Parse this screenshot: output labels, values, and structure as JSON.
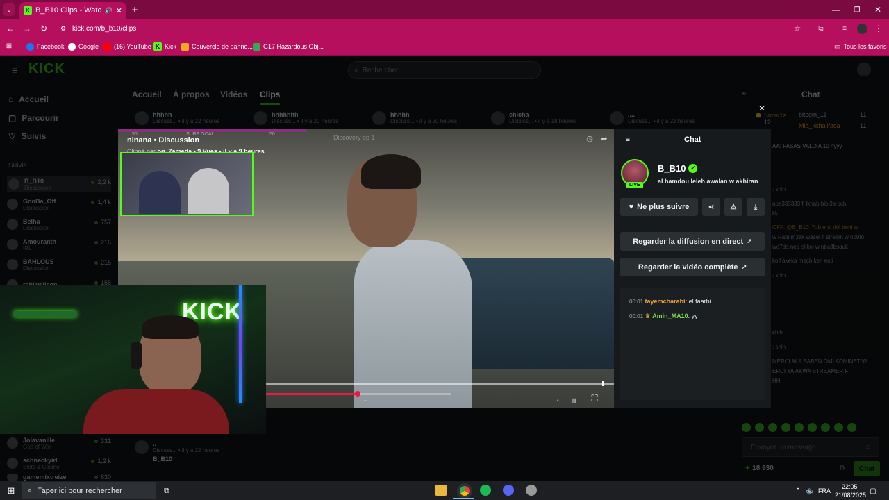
{
  "browser": {
    "tab_title": "B_B10 Clips - Watch Live o",
    "url": "kick.com/b_b10/clips",
    "bookmarks": [
      "Facebook",
      "Google",
      "(16) YouTube",
      "Kick",
      "Couvercle de panne...",
      "G17 Hazardous Obj..."
    ],
    "all_bookmarks": "Tous les favoris"
  },
  "site": {
    "logo": "KICK",
    "search_placeholder": "Rechercher",
    "nav": {
      "home": "Accueil",
      "browse": "Parcourir",
      "following": "Suivis"
    },
    "followed_label": "Suivis",
    "followed": [
      {
        "name": "B_B10",
        "sub": "Discussion",
        "count": "2,2 k"
      },
      {
        "name": "GooBa_Off",
        "sub": "Discussion",
        "count": "1,4 k"
      },
      {
        "name": "Belha",
        "sub": "Discussion",
        "count": "757"
      },
      {
        "name": "Amouranth",
        "sub": "IRL",
        "count": "216"
      },
      {
        "name": "BAHLOUS",
        "sub": "Discussion",
        "count": "215"
      },
      {
        "name": "rebiiwillson",
        "sub": "",
        "count": "158"
      }
    ],
    "followed_bottom": [
      {
        "name": "Jolavanille",
        "sub": "God of War",
        "count": "331"
      },
      {
        "name": "schneckyirl",
        "sub": "Slots & Casino",
        "count": "1,2 k"
      },
      {
        "name": "gamemixtreize",
        "sub": "",
        "count": "830"
      }
    ],
    "channel_tabs": [
      "Accueil",
      "À propos",
      "Vidéos",
      "Clips"
    ],
    "clip_cards": [
      {
        "title": "hhhhh",
        "sub": "Discuss... • il y a 22 heures"
      },
      {
        "title": "hhhhhhh",
        "sub": "Discuss... • il y a 20 heures"
      },
      {
        "title": "hhhhh",
        "sub": "Discuss... • il y a 20 heures"
      },
      {
        "title": "chicha",
        "sub": "Discuss... • il y a 18 heures"
      },
      {
        "title": "....",
        "sub": "Discuss... • il y a 22 heures"
      }
    ],
    "bottom_clip": {
      "title": "..",
      "sub": "Discuss... • il y a 22 heures",
      "channel": "B_B10"
    },
    "subs_goal": "SUBS GOAL",
    "subs_goal_nums": [
      "50",
      "50"
    ],
    "video_title_bg": "Discovery ep 1"
  },
  "clip": {
    "title": "ninana • Discussion",
    "clipped_by_prefix": "Clippé par",
    "clipped_by": "og_7ameda",
    "meta": "• 9 Vues • il y a 9 heures",
    "progress": 0.51
  },
  "chat_panel": {
    "header": "Chat",
    "channel_name": "B_B10",
    "live_badge": "LIVE",
    "stream_title": "al hamdou leleh awalan w akhiran",
    "unfollow_label": "Ne plus suivre",
    "watch_live_label": "Regarder la diffusion en direct",
    "watch_full_label": "Regarder la vidéo complète",
    "messages": [
      {
        "time": "00:01",
        "user": "tayemcharabi",
        "text": ": el faarbi",
        "color": "#f0a33a"
      },
      {
        "time": "00:01",
        "user": "Amin_MA10",
        "text": ": yy",
        "color": "#7ee04f"
      }
    ]
  },
  "right_chat": {
    "header": "Chat",
    "top_users": [
      {
        "name": "Snow1z",
        "count": "12"
      },
      {
        "name": "bitcoin_11",
        "count": "11"
      },
      {
        "name": "Mia_kkhalifasa",
        "count": "11"
      }
    ],
    "lines": [
      "AA: FASAS VALO A 10 hyyy",
      ": shih",
      "aba333333 fi lkhab bibi3a bch",
      "kk",
      "OFF: @B_B10 l7ob enti tfol behi w",
      "w Rabi m3ak wasel fl stream w no9fo",
      "we7da nes el koi w nba3bsouk",
      "koll akeka mech ken enti",
      ": shih",
      "shih",
      ": shih",
      "MERCI ALA SABEN OMI ADMINET W",
      "ERCI YA AKWA STREAMER FI",
      "HH"
    ],
    "send_placeholder": "Envoyer un message",
    "points": "18 930",
    "chat_button": "Chat"
  },
  "webcam": {
    "sign": "KICK"
  },
  "taskbar": {
    "search_placeholder": "Taper ici pour rechercher",
    "lang": "FRA",
    "time": "22:05",
    "date": "21/08/2025"
  },
  "colors": {
    "kick_green": "#53fc18",
    "browser_pink": "#b50f5d",
    "progress_red": "#e91b3f"
  }
}
